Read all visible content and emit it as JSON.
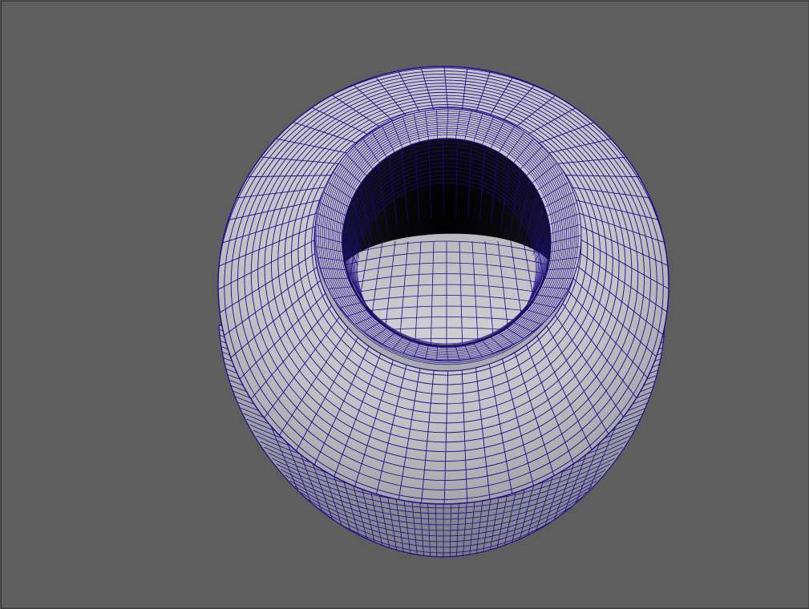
{
  "viewport": {
    "background_color": "#5e5e5e",
    "frame_color": "#3c3c3c"
  },
  "model": {
    "object": "vase",
    "display_mode": "wireframe-on-shaded",
    "surface_color": "#c4c4c8",
    "wire_color": "#1e0c8a",
    "interior_color": "#060608"
  }
}
